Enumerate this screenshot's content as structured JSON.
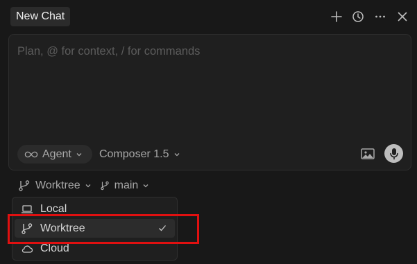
{
  "header": {
    "tab_title": "New Chat",
    "icons": [
      "plus-icon",
      "history-icon",
      "more-icon",
      "close-icon"
    ]
  },
  "composer": {
    "placeholder": "Plan, @ for context, / for commands",
    "value": "",
    "mode": {
      "label": "Agent",
      "icon": "infinity-icon"
    },
    "model": {
      "label": "Composer 1.5"
    },
    "actions": [
      "image-icon",
      "microphone-icon"
    ]
  },
  "workspace": {
    "environment": {
      "label": "Worktree",
      "icon": "branch-fork-icon"
    },
    "branch": {
      "label": "main",
      "icon": "git-branch-icon"
    }
  },
  "environment_menu": {
    "items": [
      {
        "label": "Local",
        "icon": "laptop-icon",
        "selected": false
      },
      {
        "label": "Worktree",
        "icon": "branch-fork-icon",
        "selected": true
      },
      {
        "label": "Cloud",
        "icon": "cloud-icon",
        "selected": false
      }
    ]
  },
  "colors": {
    "background": "#181818",
    "surface": "#1f1f1f",
    "highlight": "#e01010",
    "text": "#d8d8d8",
    "muted": "#a8a8a8",
    "placeholder": "#5c5c5c"
  }
}
